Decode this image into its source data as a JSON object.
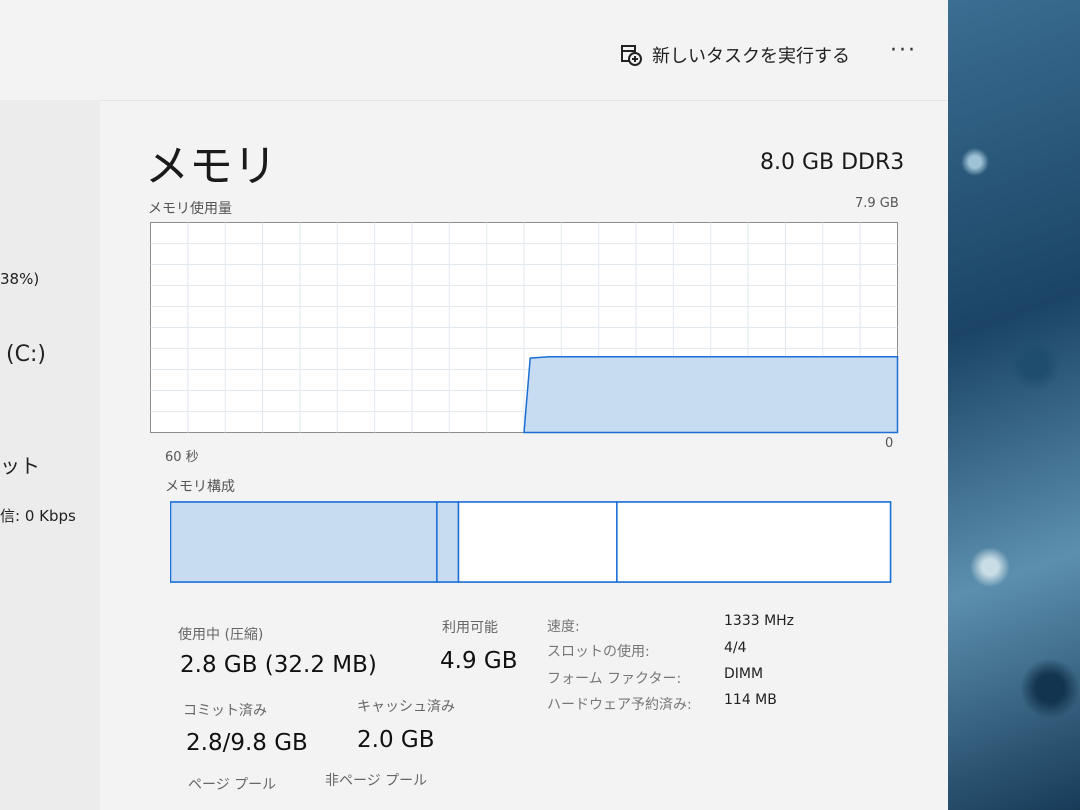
{
  "sidebar": {
    "partial_percent": "38%)",
    "disk_label": "(C:)",
    "net_fragment": "ット",
    "send_fragment": "信: 0 Kbps"
  },
  "toolbar": {
    "run_task_label": "新しいタスクを実行する",
    "more_label": "···"
  },
  "memory": {
    "title": "メモリ",
    "spec": "8.0 GB DDR3",
    "usage_label": "メモリ使用量",
    "usage_max": "7.9 GB",
    "time_span": "60 秒",
    "zero_label": "0",
    "composition_label": "メモリ構成"
  },
  "stats": {
    "in_use_label": "使用中 (圧縮)",
    "in_use_value": "2.8 GB (32.2 MB)",
    "available_label": "利用可能",
    "available_value": "4.9 GB",
    "committed_label": "コミット済み",
    "committed_value": "2.8/9.8 GB",
    "cached_label": "キャッシュ済み",
    "cached_value": "2.0 GB",
    "paged_label": "ページ プール",
    "nonpaged_label": "非ページ プール"
  },
  "specs": {
    "speed_label": "速度:",
    "speed_value": "1333 MHz",
    "slots_label": "スロットの使用:",
    "slots_value": "4/4",
    "form_label": "フォーム ファクター:",
    "form_value": "DIMM",
    "reserved_label": "ハードウェア予約済み:",
    "reserved_value": "114 MB"
  },
  "chart_data": {
    "type": "area",
    "ylabel": "メモリ使用量",
    "ylim": [
      0,
      7.9
    ],
    "xlim": [
      60,
      0
    ],
    "series": [
      {
        "x": [
          60,
          30,
          29.5,
          28,
          20,
          10,
          0
        ],
        "values": [
          0,
          0,
          2.8,
          2.85,
          2.85,
          2.85,
          2.85
        ]
      }
    ]
  },
  "composition": {
    "in_use_fraction": 0.37,
    "modified_fraction": 0.03,
    "standby_fraction": 0.22,
    "free_fraction": 0.38
  },
  "colors": {
    "accent": "#1c6fd6",
    "fill": "#c7dbf1",
    "grid": "#e1e8ee"
  }
}
